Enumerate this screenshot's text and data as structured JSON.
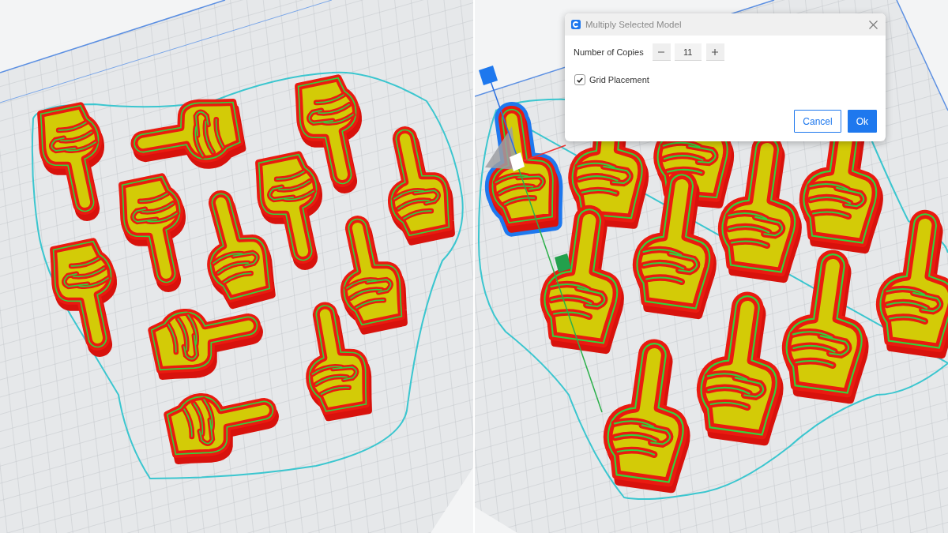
{
  "right_viewport": {
    "models": [
      {
        "selected": true
      },
      {
        "selected": false
      },
      {
        "selected": false
      },
      {
        "selected": false
      },
      {
        "selected": false
      },
      {
        "selected": false
      },
      {
        "selected": false
      },
      {
        "selected": false
      },
      {
        "selected": false
      },
      {
        "selected": false
      },
      {
        "selected": false
      }
    ]
  },
  "dialog": {
    "title": "Multiply Selected Model",
    "copies": {
      "label": "Number of Copies",
      "value": "11"
    },
    "grid_placement": {
      "label": "Grid Placement",
      "checked": true
    },
    "buttons": [
      {
        "label": "Cancel",
        "kind": "secondary"
      },
      {
        "label": "Ok",
        "kind": "primary"
      }
    ]
  }
}
